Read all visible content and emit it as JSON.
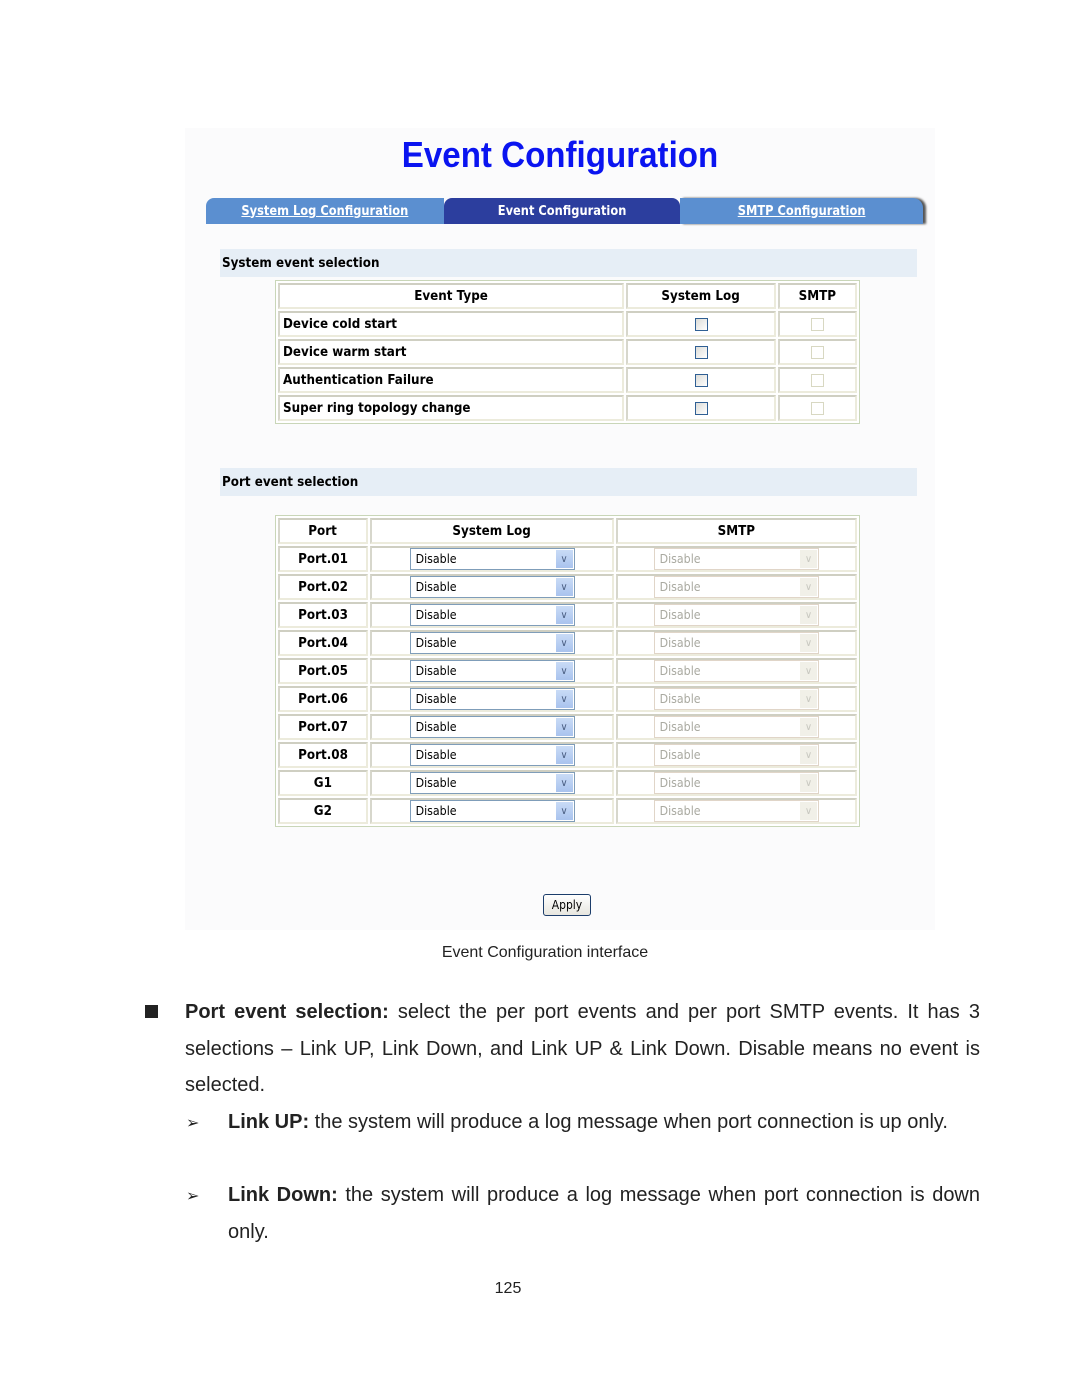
{
  "screenshot": {
    "title": "Event Configuration",
    "tabs": [
      {
        "label": "System Log Configuration",
        "active": false
      },
      {
        "label": "Event Configuration",
        "active": true
      },
      {
        "label": "SMTP Configuration",
        "active": false
      }
    ],
    "system_events": {
      "section_title": "System event selection",
      "headers": [
        "Event Type",
        "System Log",
        "SMTP"
      ],
      "rows": [
        {
          "event": "Device cold start",
          "system_log_checked": false,
          "smtp_checked": false,
          "smtp_enabled": false
        },
        {
          "event": "Device warm start",
          "system_log_checked": false,
          "smtp_checked": false,
          "smtp_enabled": false
        },
        {
          "event": "Authentication Failure",
          "system_log_checked": false,
          "smtp_checked": false,
          "smtp_enabled": false
        },
        {
          "event": "Super ring topology change",
          "system_log_checked": false,
          "smtp_checked": false,
          "smtp_enabled": false
        }
      ]
    },
    "port_events": {
      "section_title": "Port event selection",
      "headers": [
        "Port",
        "System Log",
        "SMTP"
      ],
      "rows": [
        {
          "port": "Port.01",
          "system_log": "Disable",
          "smtp": "Disable"
        },
        {
          "port": "Port.02",
          "system_log": "Disable",
          "smtp": "Disable"
        },
        {
          "port": "Port.03",
          "system_log": "Disable",
          "smtp": "Disable"
        },
        {
          "port": "Port.04",
          "system_log": "Disable",
          "smtp": "Disable"
        },
        {
          "port": "Port.05",
          "system_log": "Disable",
          "smtp": "Disable"
        },
        {
          "port": "Port.06",
          "system_log": "Disable",
          "smtp": "Disable"
        },
        {
          "port": "Port.07",
          "system_log": "Disable",
          "smtp": "Disable"
        },
        {
          "port": "Port.08",
          "system_log": "Disable",
          "smtp": "Disable"
        },
        {
          "port": "G1",
          "system_log": "Disable",
          "smtp": "Disable"
        },
        {
          "port": "G2",
          "system_log": "Disable",
          "smtp": "Disable"
        }
      ]
    },
    "apply_label": "Apply",
    "dropdown_arrow_icon": "chevron-down-icon",
    "colors": {
      "title": "#0a14f0",
      "tab_inactive": "#5b8fd0",
      "tab_active": "#2c3e9e",
      "section_bar": "#e6eef6"
    }
  },
  "document": {
    "caption": "Event Configuration interface",
    "bullet": {
      "bold": "Port event selection:",
      "text": " select the per port events and per port SMTP events. It has 3 selections – Link UP, Link Down, and Link UP & Link Down. Disable means no event is selected."
    },
    "sub_bullets": [
      {
        "bold": "Link UP:",
        "text": " the system will produce a log message when port connection is up only."
      },
      {
        "bold": "Link Down:",
        "text": " the system will produce a log message when port connection is down only."
      }
    ],
    "page_number": "125"
  }
}
